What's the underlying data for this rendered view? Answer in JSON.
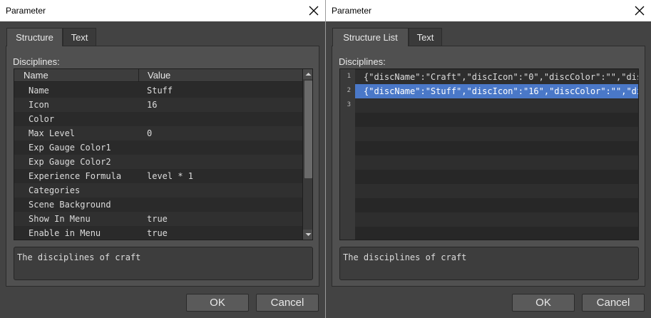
{
  "left": {
    "title": "Parameter",
    "tabs": [
      {
        "label": "Structure"
      },
      {
        "label": "Text"
      }
    ],
    "section_label": "Disciplines:",
    "columns": {
      "name": "Name",
      "value": "Value"
    },
    "rows": [
      {
        "name": "Name",
        "value": "Stuff"
      },
      {
        "name": "Icon",
        "value": "16"
      },
      {
        "name": "Color",
        "value": ""
      },
      {
        "name": "Max Level",
        "value": "0"
      },
      {
        "name": "Exp Gauge Color1",
        "value": ""
      },
      {
        "name": "Exp Gauge Color2",
        "value": ""
      },
      {
        "name": "Experience Formula",
        "value": "level * 1"
      },
      {
        "name": "Categories",
        "value": ""
      },
      {
        "name": "Scene Background",
        "value": ""
      },
      {
        "name": "Show In Menu",
        "value": "true"
      },
      {
        "name": "Enable in Menu",
        "value": "true"
      }
    ],
    "description": "The disciplines of craft",
    "ok_label": "OK",
    "cancel_label": "Cancel"
  },
  "right": {
    "title": "Parameter",
    "tabs": [
      {
        "label": "Structure List"
      },
      {
        "label": "Text"
      }
    ],
    "section_label": "Disciplines:",
    "lines": [
      {
        "num": "1",
        "text": "{\"discName\":\"Craft\",\"discIcon\":\"0\",\"discColor\":\"\",\"dis…"
      },
      {
        "num": "2",
        "text": "{\"discName\":\"Stuff\",\"discIcon\":\"16\",\"discColor\":\"\",\"di…"
      },
      {
        "num": "3",
        "text": ""
      }
    ],
    "selected_line": 2,
    "description": "The disciplines of craft",
    "ok_label": "OK",
    "cancel_label": "Cancel"
  },
  "colors": {
    "dialog_bg": "#434343",
    "selection": "#4a78c8"
  },
  "icons": {
    "close": "close-icon",
    "scroll_up": "scroll-up-arrow-icon",
    "scroll_down": "scroll-down-arrow-icon"
  }
}
